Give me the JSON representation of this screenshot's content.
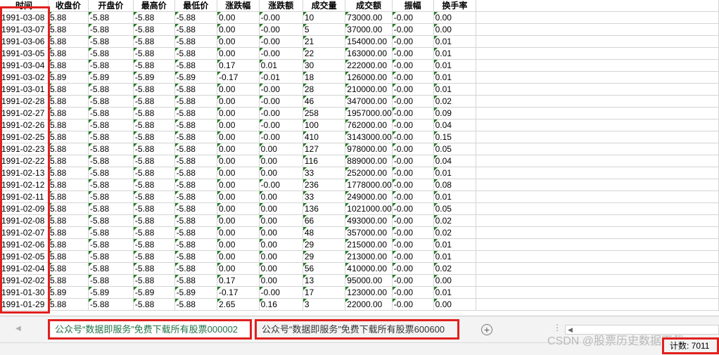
{
  "columns": [
    "时间",
    "收盘价",
    "开盘价",
    "最高价",
    "最低价",
    "涨跌幅",
    "涨跌额",
    "成交量",
    "成交额",
    "振幅",
    "换手率"
  ],
  "rows": [
    [
      "1991-03-08",
      "5.88",
      "-5.88",
      "-5.88",
      "-5.88",
      "0.00",
      "-0.00",
      "10",
      "73000.00",
      "-0.00",
      "0.00"
    ],
    [
      "1991-03-07",
      "5.88",
      "-5.88",
      "-5.88",
      "-5.88",
      "0.00",
      "-0.00",
      "5",
      "37000.00",
      "-0.00",
      "0.00"
    ],
    [
      "1991-03-06",
      "5.88",
      "-5.88",
      "-5.88",
      "-5.88",
      "0.00",
      "-0.00",
      "21",
      "154000.00",
      "-0.00",
      "0.01"
    ],
    [
      "1991-03-05",
      "5.88",
      "-5.88",
      "-5.88",
      "-5.88",
      "0.00",
      "-0.00",
      "22",
      "163000.00",
      "-0.00",
      "0.01"
    ],
    [
      "1991-03-04",
      "5.88",
      "-5.88",
      "-5.88",
      "-5.88",
      "0.17",
      "0.01",
      "30",
      "222000.00",
      "-0.00",
      "0.01"
    ],
    [
      "1991-03-02",
      "5.89",
      "-5.89",
      "-5.89",
      "-5.89",
      "-0.17",
      "-0.01",
      "18",
      "126000.00",
      "-0.00",
      "0.01"
    ],
    [
      "1991-03-01",
      "5.88",
      "-5.88",
      "-5.88",
      "-5.88",
      "0.00",
      "-0.00",
      "28",
      "210000.00",
      "-0.00",
      "0.01"
    ],
    [
      "1991-02-28",
      "5.88",
      "-5.88",
      "-5.88",
      "-5.88",
      "0.00",
      "-0.00",
      "46",
      "347000.00",
      "-0.00",
      "0.02"
    ],
    [
      "1991-02-27",
      "5.88",
      "-5.88",
      "-5.88",
      "-5.88",
      "0.00",
      "-0.00",
      "258",
      "1957000.00",
      "-0.00",
      "0.09"
    ],
    [
      "1991-02-26",
      "5.88",
      "-5.88",
      "-5.88",
      "-5.88",
      "0.00",
      "-0.00",
      "100",
      "762000.00",
      "-0.00",
      "0.04"
    ],
    [
      "1991-02-25",
      "5.88",
      "-5.88",
      "-5.88",
      "-5.88",
      "0.00",
      "-0.00",
      "410",
      "3143000.00",
      "-0.00",
      "0.15"
    ],
    [
      "1991-02-23",
      "5.88",
      "-5.88",
      "-5.88",
      "-5.88",
      "0.00",
      "0.00",
      "127",
      "978000.00",
      "-0.00",
      "0.05"
    ],
    [
      "1991-02-22",
      "5.88",
      "-5.88",
      "-5.88",
      "-5.88",
      "0.00",
      "0.00",
      "116",
      "889000.00",
      "-0.00",
      "0.04"
    ],
    [
      "1991-02-13",
      "5.88",
      "-5.88",
      "-5.88",
      "-5.88",
      "0.00",
      "0.00",
      "33",
      "252000.00",
      "-0.00",
      "0.01"
    ],
    [
      "1991-02-12",
      "5.88",
      "-5.88",
      "-5.88",
      "-5.88",
      "0.00",
      "-0.00",
      "236",
      "1778000.00",
      "-0.00",
      "0.08"
    ],
    [
      "1991-02-11",
      "5.88",
      "-5.88",
      "-5.88",
      "-5.88",
      "0.00",
      "0.00",
      "33",
      "249000.00",
      "-0.00",
      "0.01"
    ],
    [
      "1991-02-09",
      "5.88",
      "-5.88",
      "-5.88",
      "-5.88",
      "0.00",
      "0.00",
      "136",
      "1021000.00",
      "-0.00",
      "0.05"
    ],
    [
      "1991-02-08",
      "5.88",
      "-5.88",
      "-5.88",
      "-5.88",
      "0.00",
      "0.00",
      "66",
      "493000.00",
      "-0.00",
      "0.02"
    ],
    [
      "1991-02-07",
      "5.88",
      "-5.88",
      "-5.88",
      "-5.88",
      "0.00",
      "0.00",
      "48",
      "357000.00",
      "-0.00",
      "0.02"
    ],
    [
      "1991-02-06",
      "5.88",
      "-5.88",
      "-5.88",
      "-5.88",
      "0.00",
      "0.00",
      "29",
      "215000.00",
      "-0.00",
      "0.01"
    ],
    [
      "1991-02-05",
      "5.88",
      "-5.88",
      "-5.88",
      "-5.88",
      "0.00",
      "0.00",
      "29",
      "213000.00",
      "-0.00",
      "0.01"
    ],
    [
      "1991-02-04",
      "5.88",
      "-5.88",
      "-5.88",
      "-5.88",
      "0.00",
      "0.00",
      "56",
      "410000.00",
      "-0.00",
      "0.02"
    ],
    [
      "1991-02-02",
      "5.88",
      "-5.88",
      "-5.88",
      "-5.88",
      "0.17",
      "0.00",
      "13",
      "95000.00",
      "-0.00",
      "0.00"
    ],
    [
      "1991-01-30",
      "5.89",
      "-5.89",
      "-5.89",
      "-5.89",
      "-0.17",
      "-0.00",
      "17",
      "123000.00",
      "-0.00",
      "0.01"
    ],
    [
      "1991-01-29",
      "5.88",
      "-5.88",
      "-5.88",
      "-5.88",
      "2.65",
      "0.16",
      "3",
      "22000.00",
      "-0.00",
      "0.00"
    ]
  ],
  "sheet_tabs": [
    {
      "label": "公众号“数据即服务”免费下载所有股票000002",
      "active": true
    },
    {
      "label": "公众号“数据即服务”免费下载所有股票600600",
      "active": false
    }
  ],
  "status": {
    "count": "计数: 7011"
  },
  "watermark": "CSDN @股票历史数据下载",
  "icons": {
    "add_sheet": "plus-circle-icon",
    "nav_prev": "triangle-left-icon",
    "tab_more": "vertical-dots-icon",
    "scroll_left": "triangle-left-icon"
  },
  "colors": {
    "active_tab_text": "#217346",
    "highlight_box": "#e0201e",
    "cell_indicator": "#1e7b1e"
  }
}
